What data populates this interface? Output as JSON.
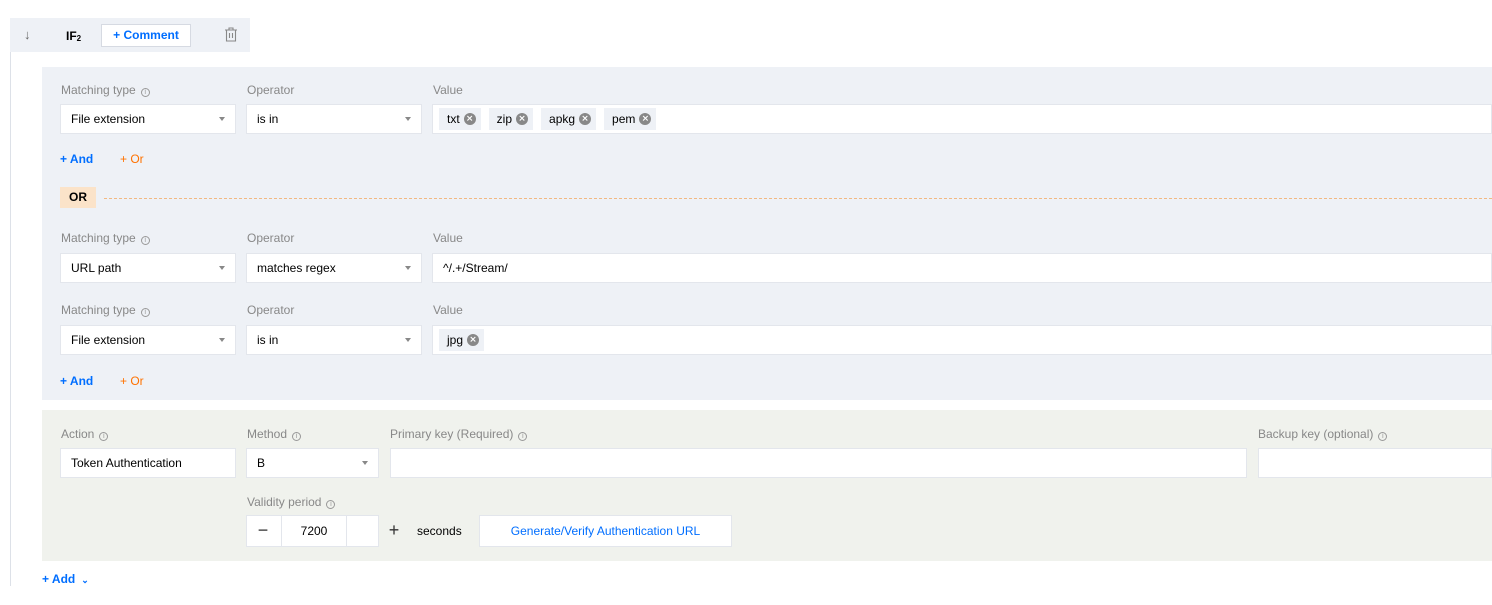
{
  "header": {
    "collapse_icon": "arrow-down-icon",
    "if_label": "IF",
    "if_index": "2",
    "comment_button": "+ Comment",
    "delete_icon": "trash-icon"
  },
  "condition_group_1": {
    "rows": [
      {
        "matching_type_label": "Matching type",
        "operator_label": "Operator",
        "value_label": "Value",
        "matching_type": "File extension",
        "operator": "is in",
        "value_tags": [
          "txt",
          "zip",
          "apkg",
          "pem"
        ]
      }
    ],
    "and_link": "+ And",
    "or_link": "+ Or"
  },
  "or_separator": "OR",
  "condition_group_2": {
    "rows": [
      {
        "matching_type_label": "Matching type",
        "operator_label": "Operator",
        "value_label": "Value",
        "matching_type": "URL path",
        "operator": "matches regex",
        "value_text": "^/.+/Stream/"
      },
      {
        "matching_type_label": "Matching type",
        "operator_label": "Operator",
        "value_label": "Value",
        "matching_type": "File extension",
        "operator": "is in",
        "value_tags": [
          "jpg"
        ]
      }
    ],
    "and_link": "+ And",
    "or_link": "+ Or"
  },
  "action": {
    "action_label": "Action",
    "action_value": "Token Authentication",
    "method_label": "Method",
    "method_value": "B",
    "primary_key_label": "Primary key (Required)",
    "primary_key_value": "",
    "backup_key_label": "Backup key (optional)",
    "backup_key_value": "",
    "validity_label": "Validity period",
    "validity_value": "7200",
    "decrement": "−",
    "increment": "+",
    "unit": "seconds",
    "generate_button": "Generate/Verify Authentication URL"
  },
  "footer": {
    "add_link": "+ Add"
  },
  "colors": {
    "accent": "#006eff",
    "or_accent": "#ff7200",
    "condition_bg": "#eef1f6",
    "action_bg": "#f0f2ed",
    "or_badge_bg": "#fbe3c9"
  }
}
